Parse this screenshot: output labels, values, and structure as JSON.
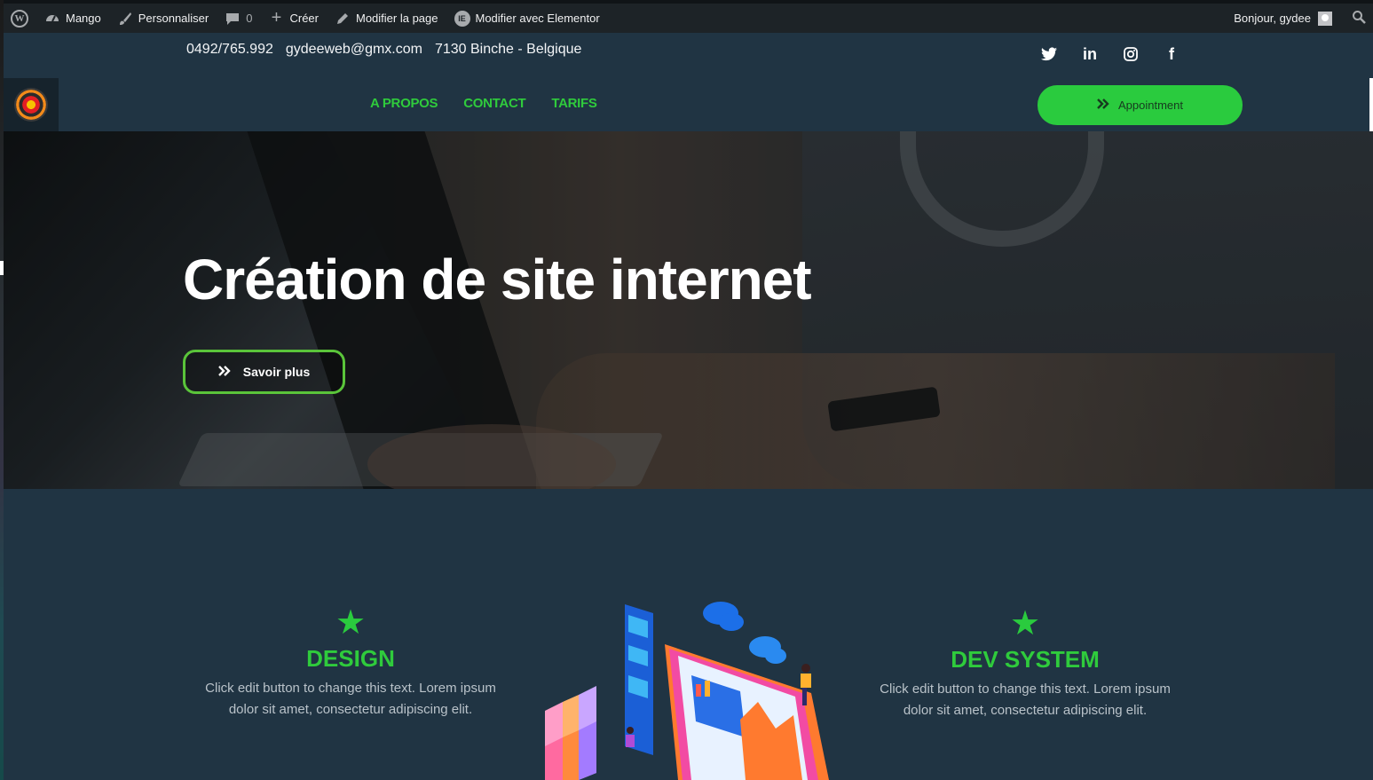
{
  "adminbar": {
    "items": [
      {
        "icon": "wordpress-logo-icon",
        "label": ""
      },
      {
        "icon": "dashboard-icon",
        "label": "Mango"
      },
      {
        "icon": "brush-icon",
        "label": "Personnaliser"
      },
      {
        "icon": "comment-icon",
        "label": "0"
      },
      {
        "icon": "plus-icon",
        "label": "Créer"
      },
      {
        "icon": "pencil-icon",
        "label": "Modifier la page"
      },
      {
        "icon": "elementor-icon",
        "label": "Modifier avec Elementor"
      }
    ],
    "greeting": "Bonjour, gydee"
  },
  "topbar": {
    "phone": "0492/765.992",
    "email": "gydeeweb@gmx.com",
    "address": "7130 Binche - Belgique"
  },
  "nav": {
    "menu": [
      "A PROPOS",
      "CONTACT",
      "TARIFS"
    ],
    "cta": "Appointment"
  },
  "hero": {
    "title": "Création de site internet",
    "button": "Savoir plus"
  },
  "services": [
    {
      "title": "DESIGN",
      "text_line1": "Click edit button to change this text. Lorem ipsum",
      "text_line2": "dolor sit amet, consectetur adipiscing elit."
    },
    {
      "title": "DEV SYSTEM",
      "text_line1": "Click edit button to change this text. Lorem ipsum",
      "text_line2": "dolor sit amet, consectetur adipiscing elit."
    }
  ],
  "colors": {
    "accent_green": "#2acb3e",
    "header_bg": "#203443",
    "adminbar_bg": "#1d2327"
  }
}
